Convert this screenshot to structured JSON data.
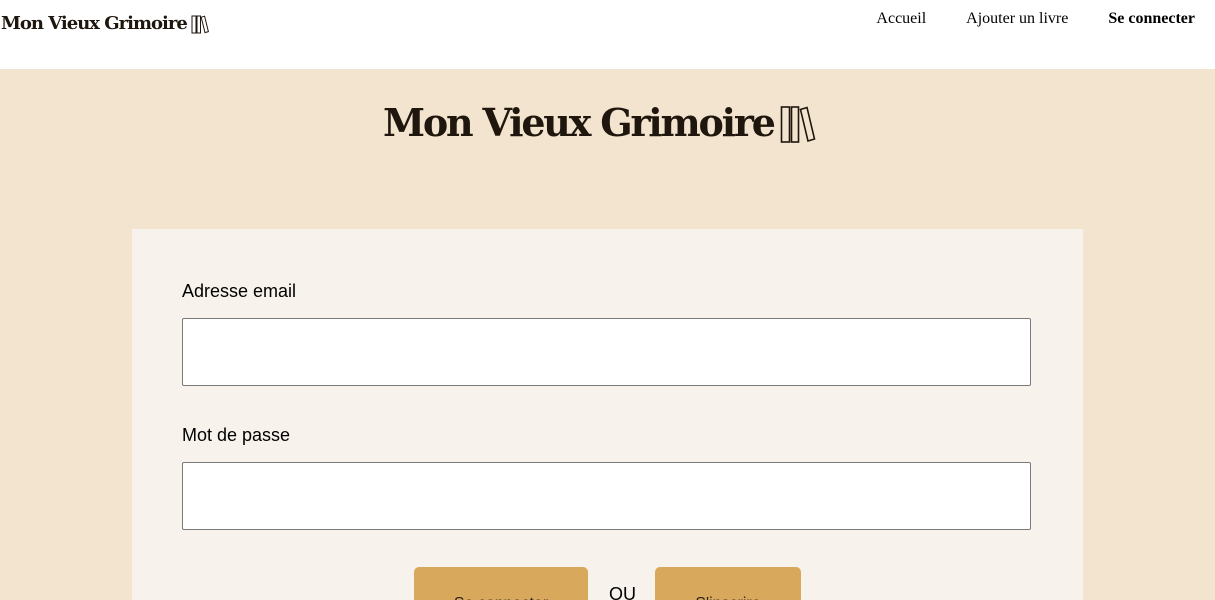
{
  "header": {
    "brand": "Mon Vieux Grimoire",
    "nav": {
      "home": "Accueil",
      "add_book": "Ajouter un livre",
      "login": "Se connecter"
    }
  },
  "hero": {
    "brand": "Mon Vieux Grimoire"
  },
  "login_form": {
    "email_label": "Adresse email",
    "email_value": "",
    "password_label": "Mot de passe",
    "password_value": "",
    "login_button": "Se connecter",
    "or_text": "OU",
    "register_button": "S'inscrire"
  },
  "icons": {
    "brand_logo": "books-icon"
  },
  "colors": {
    "header_bg": "#ffffff",
    "page_bg": "#f2e4cf",
    "card_bg": "#f7f2ec",
    "button_bg": "#d8a85c",
    "brand_text": "#1f160d"
  }
}
